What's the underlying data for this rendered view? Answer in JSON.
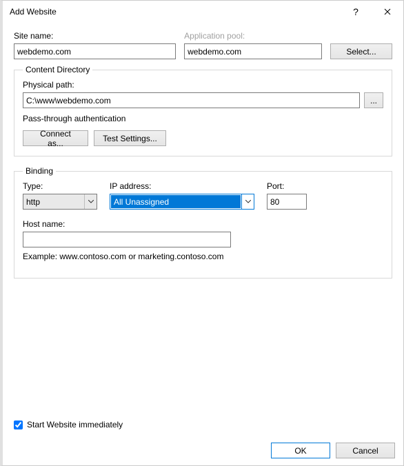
{
  "window": {
    "title": "Add Website"
  },
  "site": {
    "label": "Site name:",
    "value": "webdemo.com"
  },
  "pool": {
    "label": "Application pool:",
    "value": "webdemo.com",
    "select_btn": "Select..."
  },
  "content_dir": {
    "legend": "Content Directory",
    "physical_label": "Physical path:",
    "physical_value": "C:\\www\\webdemo.com",
    "browse_btn": "...",
    "passthru": "Pass-through authentication",
    "connect_btn": "Connect as...",
    "test_btn": "Test Settings..."
  },
  "binding": {
    "legend": "Binding",
    "type_label": "Type:",
    "type_value": "http",
    "ip_label": "IP address:",
    "ip_value": "All Unassigned",
    "port_label": "Port:",
    "port_value": "80",
    "hostname_label": "Host name:",
    "hostname_value": "",
    "example": "Example: www.contoso.com or marketing.contoso.com"
  },
  "start_immediately": {
    "label": "Start Website immediately",
    "checked": true
  },
  "buttons": {
    "ok": "OK",
    "cancel": "Cancel"
  }
}
